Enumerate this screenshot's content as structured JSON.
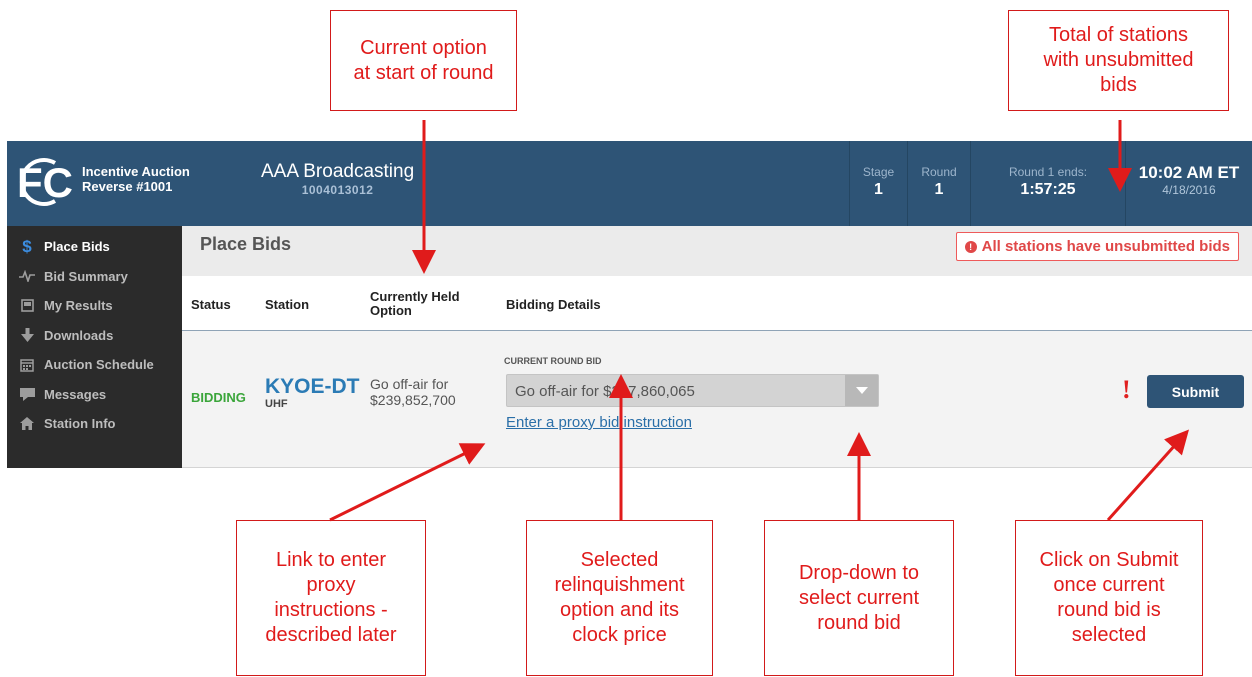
{
  "header": {
    "auction_line1": "Incentive Auction",
    "auction_line2": "Reverse #1001",
    "bidder_name": "AAA Broadcasting",
    "bidder_id": "1004013012",
    "stage_label": "Stage",
    "stage_value": "1",
    "round_label": "Round",
    "round_value": "1",
    "round_ends_label": "Round 1 ends:",
    "round_ends_value": "1:57:25",
    "time": "10:02 AM ET",
    "date": "4/18/2016",
    "logo_text": "FC"
  },
  "sidebar": {
    "items": [
      {
        "label": "Place Bids",
        "icon": "dollar-icon",
        "glyph": "$"
      },
      {
        "label": "Bid Summary",
        "icon": "pulse-icon",
        "glyph": "∿"
      },
      {
        "label": "My Results",
        "icon": "results-icon",
        "glyph": "▣"
      },
      {
        "label": "Downloads",
        "icon": "download-icon",
        "glyph": "🡫"
      },
      {
        "label": "Auction Schedule",
        "icon": "calendar-icon",
        "glyph": "▦"
      },
      {
        "label": "Messages",
        "icon": "message-icon",
        "glyph": "▰"
      },
      {
        "label": "Station Info",
        "icon": "home-icon",
        "glyph": "⌂"
      }
    ]
  },
  "main": {
    "title": "Place Bids",
    "alert": "All stations have unsubmitted bids",
    "alert_glyph": "!",
    "columns": {
      "status": "Status",
      "station": "Station",
      "held_line1": "Currently Held",
      "held_line2": "Option",
      "details": "Bidding Details"
    },
    "row": {
      "status": "BIDDING",
      "callsign": "KYOE-DT",
      "band": "UHF",
      "held_line1": "Go off-air for",
      "held_line2": "$239,852,700",
      "current_round_bid_label": "CURRENT ROUND BID",
      "current_round_bid_value": "Go off-air for $227,860,065",
      "proxy_link": "Enter a proxy bid instruction",
      "warning_glyph": "!",
      "submit_label": "Submit"
    }
  },
  "callouts": {
    "current_option": "Current option\nat start of round",
    "total_stations": "Total of stations\nwith unsubmitted\nbids",
    "proxy_link": "Link to enter\nproxy\ninstructions -\ndescribed later",
    "selected_option": "Selected\nrelinquishment\noption and its\nclock price",
    "dropdown": "Drop-down to\nselect current\nround bid",
    "submit": "Click on Submit\nonce current\nround bid is\nselected"
  },
  "colors": {
    "header_bg": "#2e5476",
    "sidebar_bg": "#2b2b2b",
    "accent_blue": "#2b7bb5",
    "bidding_green": "#3aa53a",
    "alert_red": "#e04848",
    "callout_red": "#e01b1b"
  }
}
